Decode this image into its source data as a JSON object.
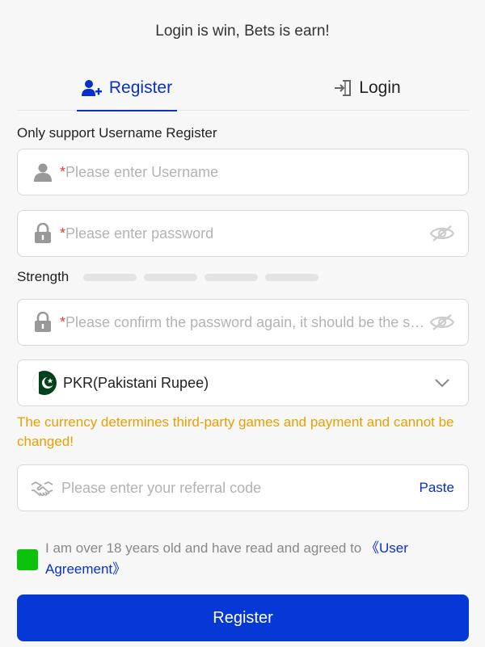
{
  "slogan": "Login is win, Bets is earn!",
  "tabs": {
    "register": "Register",
    "login": "Login"
  },
  "form": {
    "section_label": "Only support Username Register",
    "username": {
      "required_mark": "*",
      "placeholder": "Please enter Username"
    },
    "password": {
      "required_mark": "*",
      "placeholder": "Please enter password"
    },
    "strength_label": "Strength",
    "strength_level": 0,
    "confirm": {
      "required_mark": "*",
      "placeholder": "Please confirm the password again, it should be the same as the password"
    },
    "currency": {
      "value": "PKR(Pakistani Rupee)"
    },
    "currency_warning": "The currency determines third-party games and payment and cannot be changed!",
    "referral": {
      "placeholder": "Please enter your referral code",
      "paste_label": "Paste"
    },
    "agreement": {
      "text": "I am over 18 years old and have read and agreed to ",
      "link": "《User Agreement》",
      "checked": true
    },
    "submit_label": "Register"
  },
  "colors": {
    "accent": "#0638d6",
    "warning": "#e8a000",
    "checkbox": "#0ac30a",
    "required": "#e23b3b"
  },
  "icons": [
    "user-plus-icon",
    "login-door-icon",
    "user-icon",
    "lock-icon",
    "eye-off-icon",
    "pakistan-flag-icon",
    "chevron-down-icon",
    "handshake-icon"
  ]
}
